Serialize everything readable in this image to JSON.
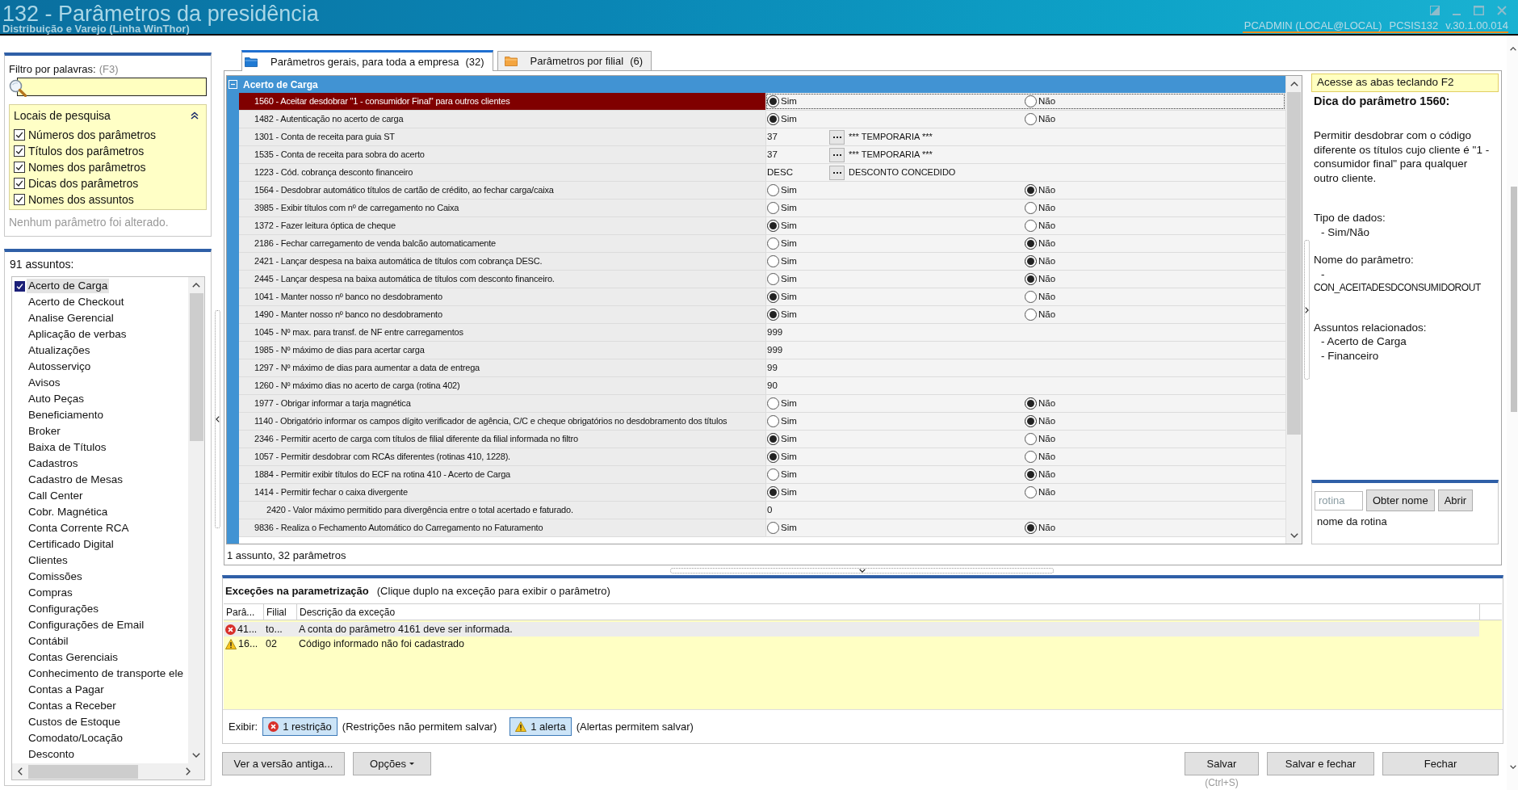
{
  "header": {
    "title": "132 - Parâmetros da presidência",
    "subtitle": "Distribuição e Varejo (Linha WinThor)",
    "user": "PCADMIN (LOCAL@LOCAL)",
    "program": "PCSIS132",
    "version": "v.30.1.00.014"
  },
  "filter": {
    "label": "Filtro por palavras:",
    "shortcut": "(F3)"
  },
  "search_locations": {
    "title": "Locais de pesquisa",
    "expanded": true,
    "options": [
      {
        "label": "Números dos parâmetros",
        "checked": true
      },
      {
        "label": "Títulos dos parâmetros",
        "checked": true
      },
      {
        "label": "Nomes dos parâmetros",
        "checked": true
      },
      {
        "label": "Dicas dos parâmetros",
        "checked": true
      },
      {
        "label": "Nomes dos assuntos",
        "checked": true
      }
    ]
  },
  "change_status": "Nenhum parâmetro foi alterado.",
  "subjects": {
    "count": "91 assuntos:",
    "items": [
      {
        "label": "Acerto de Carga",
        "checked": true,
        "selected": true
      },
      {
        "label": "Acerto de Checkout",
        "checked": false,
        "selected": false
      },
      {
        "label": "Analise Gerencial",
        "checked": false,
        "selected": false
      },
      {
        "label": "Aplicação de verbas",
        "checked": false,
        "selected": false
      },
      {
        "label": "Atualizações",
        "checked": false,
        "selected": false
      },
      {
        "label": "Autosserviço",
        "checked": false,
        "selected": false
      },
      {
        "label": "Avisos",
        "checked": false,
        "selected": false
      },
      {
        "label": "Auto Peças",
        "checked": false,
        "selected": false
      },
      {
        "label": "Beneficiamento",
        "checked": false,
        "selected": false
      },
      {
        "label": "Broker",
        "checked": false,
        "selected": false
      },
      {
        "label": "Baixa de Títulos",
        "checked": false,
        "selected": false
      },
      {
        "label": "Cadastros",
        "checked": false,
        "selected": false
      },
      {
        "label": "Cadastro de Mesas",
        "checked": false,
        "selected": false
      },
      {
        "label": "Call Center",
        "checked": false,
        "selected": false
      },
      {
        "label": "Cobr. Magnética",
        "checked": false,
        "selected": false
      },
      {
        "label": "Conta Corrente RCA",
        "checked": false,
        "selected": false
      },
      {
        "label": "Certificado Digital",
        "checked": false,
        "selected": false
      },
      {
        "label": "Clientes",
        "checked": false,
        "selected": false
      },
      {
        "label": "Comissões",
        "checked": false,
        "selected": false
      },
      {
        "label": "Compras",
        "checked": false,
        "selected": false
      },
      {
        "label": "Configurações",
        "checked": false,
        "selected": false
      },
      {
        "label": "Configurações de Email",
        "checked": false,
        "selected": false
      },
      {
        "label": "Contábil",
        "checked": false,
        "selected": false
      },
      {
        "label": "Contas Gerenciais",
        "checked": false,
        "selected": false
      },
      {
        "label": "Conhecimento de transporte ele",
        "checked": false,
        "selected": false
      },
      {
        "label": "Contas a Pagar",
        "checked": false,
        "selected": false
      },
      {
        "label": "Contas a Receber",
        "checked": false,
        "selected": false
      },
      {
        "label": "Custos de Estoque",
        "checked": false,
        "selected": false
      },
      {
        "label": "Comodato/Locação",
        "checked": false,
        "selected": false
      },
      {
        "label": "Desconto",
        "checked": false,
        "selected": false
      }
    ]
  },
  "tabs": [
    {
      "label": "Parâmetros gerais, para toda a empresa",
      "count": "(32)",
      "selected": true
    },
    {
      "label": "Parâmetros por filial",
      "count": "(6)",
      "selected": false
    }
  ],
  "grid": {
    "group": {
      "title": "Acerto de Carga",
      "expanded": true
    },
    "rows": [
      {
        "label": "1560 - Aceitar desdobrar \"1 - consumidor Final\" para outros clientes",
        "selected": true,
        "value": {
          "kind": "options",
          "options": [
            {
              "label": "Sim",
              "selected": true
            },
            {
              "label": "Não",
              "selected": false
            }
          ]
        }
      },
      {
        "label": "1482 - Autenticação no acerto de carga",
        "selected": false,
        "value": {
          "kind": "options",
          "options": [
            {
              "label": "Sim",
              "selected": true
            },
            {
              "label": "Não",
              "selected": false
            }
          ]
        }
      },
      {
        "label": "1301 - Conta de receita para guia ST",
        "selected": false,
        "value": {
          "kind": "lookup",
          "code": "37",
          "description": "*** TEMPORARIA ***"
        }
      },
      {
        "label": "1535 - Conta de receita para sobra do acerto",
        "selected": false,
        "value": {
          "kind": "lookup",
          "code": "37",
          "description": "*** TEMPORARIA ***"
        }
      },
      {
        "label": "1223 - Cód. cobrança desconto financeiro",
        "selected": false,
        "value": {
          "kind": "lookup",
          "code": "DESC",
          "description": "DESCONTO CONCEDIDO"
        }
      },
      {
        "label": "1564 - Desdobrar automático títulos de cartão de crédito, ao fechar carga/caixa",
        "selected": false,
        "value": {
          "kind": "options",
          "options": [
            {
              "label": "Sim",
              "selected": false
            },
            {
              "label": "Não",
              "selected": true
            }
          ]
        }
      },
      {
        "label": "3985 - Exibir títulos com nº de carregamento no Caixa",
        "selected": false,
        "value": {
          "kind": "options",
          "options": [
            {
              "label": "Sim",
              "selected": false
            },
            {
              "label": "Não",
              "selected": false
            }
          ]
        }
      },
      {
        "label": "1372 - Fazer leitura óptica de cheque",
        "selected": false,
        "value": {
          "kind": "options",
          "options": [
            {
              "label": "Sim",
              "selected": true
            },
            {
              "label": "Não",
              "selected": false
            }
          ]
        }
      },
      {
        "label": "2186 - Fechar carregamento de venda balcão automaticamente",
        "selected": false,
        "value": {
          "kind": "options",
          "options": [
            {
              "label": "Sim",
              "selected": false
            },
            {
              "label": "Não",
              "selected": true
            }
          ]
        }
      },
      {
        "label": "2421 - Lançar despesa na baixa automática de títulos com cobrança DESC.",
        "selected": false,
        "value": {
          "kind": "options",
          "options": [
            {
              "label": "Sim",
              "selected": false
            },
            {
              "label": "Não",
              "selected": true
            }
          ]
        }
      },
      {
        "label": "2445 - Lançar despesa na baixa automática de títulos com desconto financeiro.",
        "selected": false,
        "value": {
          "kind": "options",
          "options": [
            {
              "label": "Sim",
              "selected": false
            },
            {
              "label": "Não",
              "selected": true
            }
          ]
        }
      },
      {
        "label": "1041 - Manter nosso nº banco no desdobramento",
        "selected": false,
        "value": {
          "kind": "options",
          "options": [
            {
              "label": "Sim",
              "selected": true
            },
            {
              "label": "Não",
              "selected": false
            }
          ]
        }
      },
      {
        "label": "1490 - Manter nosso nº banco no desdobramento",
        "selected": false,
        "value": {
          "kind": "options",
          "options": [
            {
              "label": "Sim",
              "selected": true
            },
            {
              "label": "Não",
              "selected": false
            }
          ]
        }
      },
      {
        "label": "1045 - Nº max. para transf. de NF entre carregamentos",
        "selected": false,
        "value": {
          "kind": "text",
          "text": "999"
        }
      },
      {
        "label": "1985 - Nº máximo de dias para acertar carga",
        "selected": false,
        "value": {
          "kind": "text",
          "text": "999"
        }
      },
      {
        "label": "1297 - Nº máximo de dias para aumentar a data de entrega",
        "selected": false,
        "value": {
          "kind": "text",
          "text": "99"
        }
      },
      {
        "label": "1260 - Nº máximo dias no acerto de carga (rotina 402)",
        "selected": false,
        "value": {
          "kind": "text",
          "text": "90"
        }
      },
      {
        "label": "1977 - Obrigar informar a tarja magnética",
        "selected": false,
        "value": {
          "kind": "options",
          "options": [
            {
              "label": "Sim",
              "selected": false
            },
            {
              "label": "Não",
              "selected": true
            }
          ]
        }
      },
      {
        "label": "1140 - Obrigatório informar os campos dígito verificador de agência, C/C e cheque obrigatórios no desdobramento dos títulos",
        "selected": false,
        "value": {
          "kind": "options",
          "options": [
            {
              "label": "Sim",
              "selected": false
            },
            {
              "label": "Não",
              "selected": true
            }
          ]
        }
      },
      {
        "label": "2346 - Permitir acerto de carga com títulos de filial diferente da filial informada no filtro",
        "selected": false,
        "value": {
          "kind": "options",
          "options": [
            {
              "label": "Sim",
              "selected": true
            },
            {
              "label": "Não",
              "selected": false
            }
          ]
        }
      },
      {
        "label": "1057 - Permitir desdobrar com RCAs diferentes (rotinas 410, 1228).",
        "selected": false,
        "value": {
          "kind": "options",
          "options": [
            {
              "label": "Sim",
              "selected": true
            },
            {
              "label": "Não",
              "selected": false
            }
          ]
        }
      },
      {
        "label": "1884 - Permitir exibir títulos do ECF na rotina 410 - Acerto de Carga",
        "selected": false,
        "value": {
          "kind": "options",
          "options": [
            {
              "label": "Sim",
              "selected": false
            },
            {
              "label": "Não",
              "selected": true
            }
          ]
        }
      },
      {
        "label": "1414 - Permitir fechar o caixa divergente",
        "selected": false,
        "value": {
          "kind": "options",
          "options": [
            {
              "label": "Sim",
              "selected": true
            },
            {
              "label": "Não",
              "selected": false
            }
          ]
        },
        "children": [
          {
            "label": "2420 - Valor máximo permitido para divergência entre o total acertado e faturado.",
            "selected": false,
            "value": {
              "kind": "text",
              "text": "0"
            }
          }
        ]
      },
      {
        "label": "9836 - Realiza o Fechamento Automático do Carregamento no Faturamento",
        "selected": false,
        "value": {
          "kind": "options",
          "options": [
            {
              "label": "Sim",
              "selected": false
            },
            {
              "label": "Não",
              "selected": true
            }
          ]
        }
      }
    ],
    "summary": "1 assunto, 32 parâmetros"
  },
  "tip_panel": {
    "hint": "Acesse as abas teclando F2",
    "title": "Dica do parâmetro 1560:",
    "description": "Permitir desdobrar com o código diferente os títulos cujo cliente é \"1 - consumidor final\" para qualquer outro cliente.",
    "sections": [
      {
        "heading": "Tipo de dados:",
        "lines": [
          {
            "kind": "item",
            "text": "- Sim/Não"
          }
        ]
      },
      {
        "heading": "Nome do parâmetro:",
        "lines": [
          {
            "kind": "item",
            "text": "-"
          },
          {
            "kind": "code",
            "text": "CON_ACEITADESDCONSUMIDOROUT"
          }
        ]
      },
      {
        "heading": "Assuntos relacionados:",
        "lines": [
          {
            "kind": "item",
            "text": "- Acerto de Carga"
          },
          {
            "kind": "item",
            "text": "- Financeiro"
          }
        ]
      }
    ],
    "routine": {
      "placeholder": "rotina",
      "buttons": [
        "Obter nome",
        "Abrir"
      ],
      "result": "nome da rotina"
    }
  },
  "exceptions": {
    "title": "Exceções na parametrização",
    "note": "(Clique duplo na exceção para exibir o parâmetro)",
    "columns": [
      "Parâ...",
      "Filial",
      "Descrição da exceção"
    ],
    "rows": [
      {
        "kind": "error",
        "selected": true,
        "cells": [
          "41...",
          "to...",
          "A conta do parâmetro 4161 deve ser informada."
        ]
      },
      {
        "kind": "warning",
        "selected": false,
        "cells": [
          "16...",
          "02",
          "Código informado não foi cadastrado"
        ]
      }
    ],
    "filters": {
      "label": "Exibir:",
      "items": [
        {
          "kind": "error",
          "label": "1 restrição",
          "note": "(Restrições não permitem salvar)",
          "on": true
        },
        {
          "kind": "warning",
          "label": "1 alerta",
          "note": "(Alertas permitem salvar)",
          "on": true
        }
      ]
    }
  },
  "buttons": {
    "left": [
      {
        "label": "Ver a versão antiga...",
        "kind": "plain"
      },
      {
        "label": "Opções",
        "kind": "menu"
      }
    ],
    "right": [
      {
        "label": "Salvar",
        "shortcut": "(Ctrl+S)"
      },
      {
        "label": "Salvar e fechar"
      },
      {
        "label": "Fechar"
      }
    ]
  }
}
